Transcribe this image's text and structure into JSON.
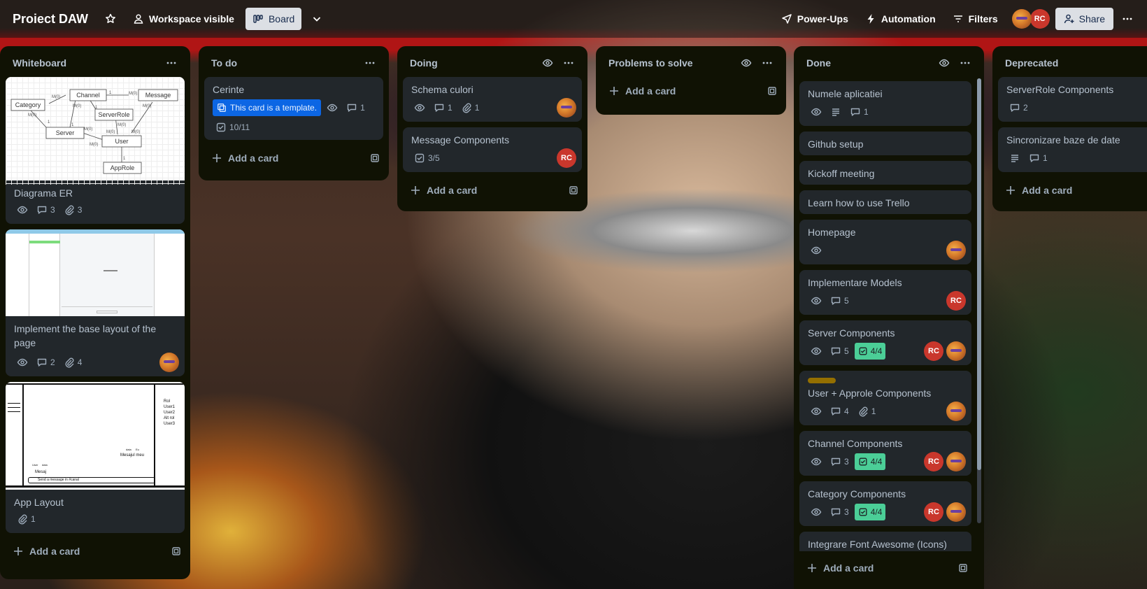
{
  "header": {
    "board_title": "Proiect DAW",
    "visibility_label": "Workspace visible",
    "view_label": "Board",
    "powerups_label": "Power-Ups",
    "automation_label": "Automation",
    "filters_label": "Filters",
    "member_initials": "RC",
    "share_label": "Share"
  },
  "colors": {
    "accent": "#0c66e4",
    "list_bg": "#101204",
    "card_bg": "#22272b",
    "complete_badge": "#4bce97",
    "member_rc": "#c9372c",
    "label_yellow": "#946f00"
  },
  "add_card_label": "Add a card",
  "lists": [
    {
      "title": "Whiteboard",
      "cards": [
        {
          "title": "Diagrama ER",
          "comments": "3",
          "attachments": "3"
        },
        {
          "title": "Implement the base layout of the page",
          "comments": "2",
          "attachments": "4"
        },
        {
          "title": "App Layout",
          "attachments": "1"
        }
      ]
    },
    {
      "title": "To do",
      "cards": [
        {
          "title": "Cerinte",
          "template_badge": "This card is a template.",
          "comments": "1",
          "checklist": "10/11"
        }
      ]
    },
    {
      "title": "Doing",
      "cards": [
        {
          "title": "Schema culori",
          "comments": "1",
          "attachments": "1"
        },
        {
          "title": "Message Components",
          "checklist": "3/5",
          "member": "RC"
        }
      ]
    },
    {
      "title": "Problems to solve",
      "cards": []
    },
    {
      "title": "Done",
      "cards": [
        {
          "title": "Numele aplicatiei",
          "comments": "1"
        },
        {
          "title": "Github setup"
        },
        {
          "title": "Kickoff meeting"
        },
        {
          "title": "Learn how to use Trello"
        },
        {
          "title": "Homepage"
        },
        {
          "title": "Implementare Models",
          "comments": "5",
          "member": "RC"
        },
        {
          "title": "Server Components",
          "comments": "5",
          "checklist": "4/4",
          "member": "RC"
        },
        {
          "title": "User + Approle Components",
          "comments": "4",
          "attachments": "1"
        },
        {
          "title": "Channel Components",
          "comments": "3",
          "checklist": "4/4",
          "member": "RC"
        },
        {
          "title": "Category Components",
          "comments": "3",
          "checklist": "4/4",
          "member": "RC"
        },
        {
          "title": "Integrare Font Awesome (Icons)"
        }
      ]
    },
    {
      "title": "Deprecated",
      "cards": [
        {
          "title": "ServerRole Components",
          "comments": "2"
        },
        {
          "title": "Sincronizare baze de date",
          "comments": "1"
        }
      ]
    }
  ],
  "covers": {
    "er": {
      "boxes": [
        "Category",
        "Channel",
        "Message",
        "ServerRole",
        "Server",
        "User",
        "AppRole"
      ],
      "edges": [
        "M(0)",
        "M(0)",
        "M(0)",
        "M(0)",
        "M(0)",
        "M(0)",
        "M(0)",
        "M(0)",
        "M(0)",
        "M(0)",
        "1",
        "1",
        "1",
        "1",
        "1"
      ]
    },
    "layout": {
      "users": [
        "Rol",
        "User1",
        "User2",
        "Alt rol",
        "User3"
      ],
      "msg_user_1": "User",
      "msg_date_1": "data",
      "msg_text_1": "Mesaj",
      "msg_user_2": "data",
      "msg_date_2": "Eu",
      "msg_text_2": "Mesajul meu",
      "input_placeholder": "Send a message in #canal"
    }
  }
}
